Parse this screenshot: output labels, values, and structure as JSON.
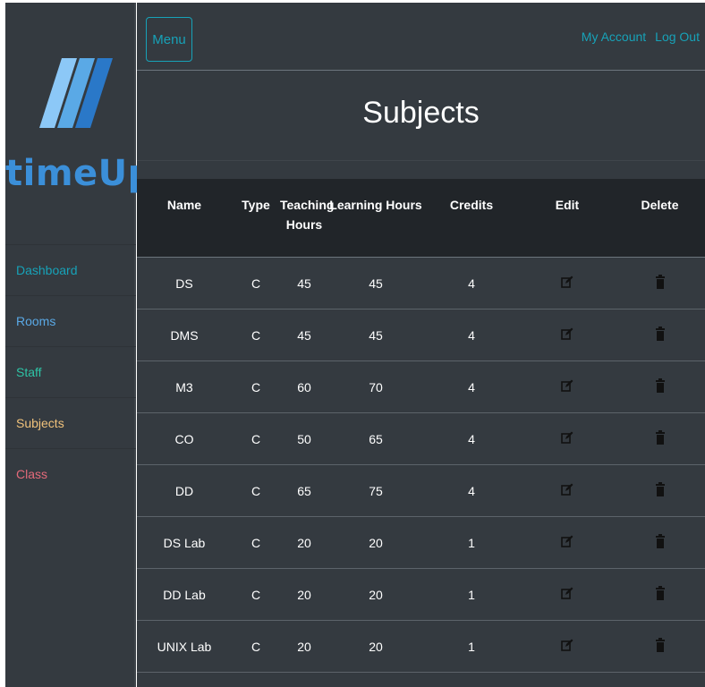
{
  "app": {
    "logo_text": "timeUp"
  },
  "sidebar": {
    "items": [
      {
        "label": "Dashboard",
        "color": "#17a2b8"
      },
      {
        "label": "Rooms",
        "color": "#5aa9e6"
      },
      {
        "label": "Staff",
        "color": "#2ec4a6"
      },
      {
        "label": "Subjects",
        "color": "#f0c27b"
      },
      {
        "label": "Class",
        "color": "#e36a7a"
      }
    ]
  },
  "header": {
    "menu_label": "Menu",
    "my_account": "My Account",
    "log_out": "Log Out"
  },
  "page": {
    "title": "Subjects"
  },
  "table": {
    "columns": {
      "name": "Name",
      "type": "Type",
      "teaching": "Teaching Hours",
      "learning": "Learning Hours",
      "credits": "Credits",
      "edit": "Edit",
      "delete": "Delete"
    },
    "rows": [
      {
        "name": "DS",
        "type": "C",
        "teaching": "45",
        "learning": "45",
        "credits": "4"
      },
      {
        "name": "DMS",
        "type": "C",
        "teaching": "45",
        "learning": "45",
        "credits": "4"
      },
      {
        "name": "M3",
        "type": "C",
        "teaching": "60",
        "learning": "70",
        "credits": "4"
      },
      {
        "name": "CO",
        "type": "C",
        "teaching": "50",
        "learning": "65",
        "credits": "4"
      },
      {
        "name": "DD",
        "type": "C",
        "teaching": "65",
        "learning": "75",
        "credits": "4"
      },
      {
        "name": "DS Lab",
        "type": "C",
        "teaching": "20",
        "learning": "20",
        "credits": "1"
      },
      {
        "name": "DD Lab",
        "type": "C",
        "teaching": "20",
        "learning": "20",
        "credits": "1"
      },
      {
        "name": "UNIX Lab",
        "type": "C",
        "teaching": "20",
        "learning": "20",
        "credits": "1"
      }
    ]
  },
  "icons": {
    "edit": "edit-icon",
    "delete": "trash-icon"
  },
  "colors": {
    "accent": "#17a2b8",
    "logo": "#3b8fd9",
    "panel": "#343a40",
    "table_head": "#212529"
  }
}
